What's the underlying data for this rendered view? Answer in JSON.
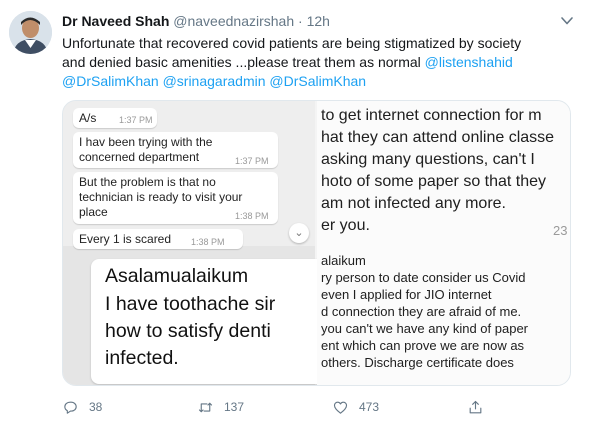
{
  "tweet": {
    "author_name": "Dr Naveed Shah",
    "handle": "@naveednazirshah",
    "separator": "·",
    "time": "12h",
    "text_lines": [
      "Unfortunate that recovered covid patients are being stigmatized by society",
      "and denied basic amenities ...please treat them as normal",
      "@DrSalimKhan @srinagaradmin @DrSalimKhan"
    ],
    "mention_inline": "@listenshahid"
  },
  "media": {
    "left": {
      "header": "A/s",
      "header_time": "1:37 PM",
      "msg1_lines": [
        "I hav been trying with the",
        "concerned department"
      ],
      "msg1_time": "1:37 PM",
      "msg2_lines": [
        "But the problem is that no",
        "technician is ready to visit your",
        "place"
      ],
      "msg2_time": "1:38 PM",
      "msg3": "Every 1 is scared",
      "msg3_time": "1:38 PM",
      "big_lines": [
        "Asalamualaikum",
        "I have toothache sir",
        "how to satisfy denti",
        "infected."
      ]
    },
    "right": {
      "top_lines": [
        "to get internet connection for m",
        "hat they can attend online classe",
        "asking many questions, can't I",
        "hoto of some paper so that they",
        "am not infected any more.",
        "er you."
      ],
      "counter": "23",
      "bottom_lines": [
        "alaikum",
        "ry person to date consider us Covid",
        "even I applied for JIO internet",
        "d connection they are afraid of me.",
        "you can't we have any kind of paper",
        "ent which can prove we are now as",
        "others. Discharge certificate does"
      ]
    }
  },
  "actions": {
    "replies": "38",
    "retweets": "137",
    "likes": "473"
  },
  "colors": {
    "link": "#1da1f2",
    "muted": "#657786",
    "text": "#14171a"
  }
}
